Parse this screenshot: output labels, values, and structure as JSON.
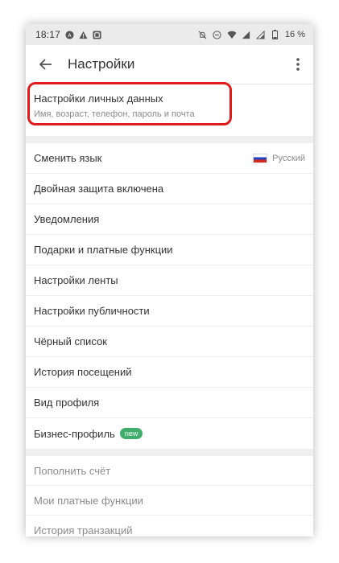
{
  "status_bar": {
    "time": "18:17",
    "battery": "16 %",
    "left_icons": [
      "app-a-icon",
      "warning-icon",
      "square-app-icon"
    ],
    "right_icons": [
      "bell-off-icon",
      "do-not-disturb-icon",
      "wifi-icon",
      "signal-icon",
      "signal-icon",
      "battery-icon"
    ]
  },
  "toolbar": {
    "title": "Настройки"
  },
  "personal_data": {
    "title": "Настройки личных данных",
    "subtitle": "Имя, возраст, телефон, пароль и почта",
    "highlight_color": "#e01b1b"
  },
  "menu": {
    "language_label": "Сменить язык",
    "language_value": "Русский",
    "items": [
      "Двойная защита включена",
      "Уведомления",
      "Подарки и платные функции",
      "Настройки ленты",
      "Настройки публичности",
      "Чёрный список",
      "История посещений",
      "Вид профиля"
    ],
    "business_label": "Бизнес-профиль",
    "business_badge": "new",
    "badge_color": "#3fae6a"
  },
  "payments": {
    "items": [
      "Пополнить счёт",
      "Мои платные функции",
      "История транзакций"
    ]
  }
}
